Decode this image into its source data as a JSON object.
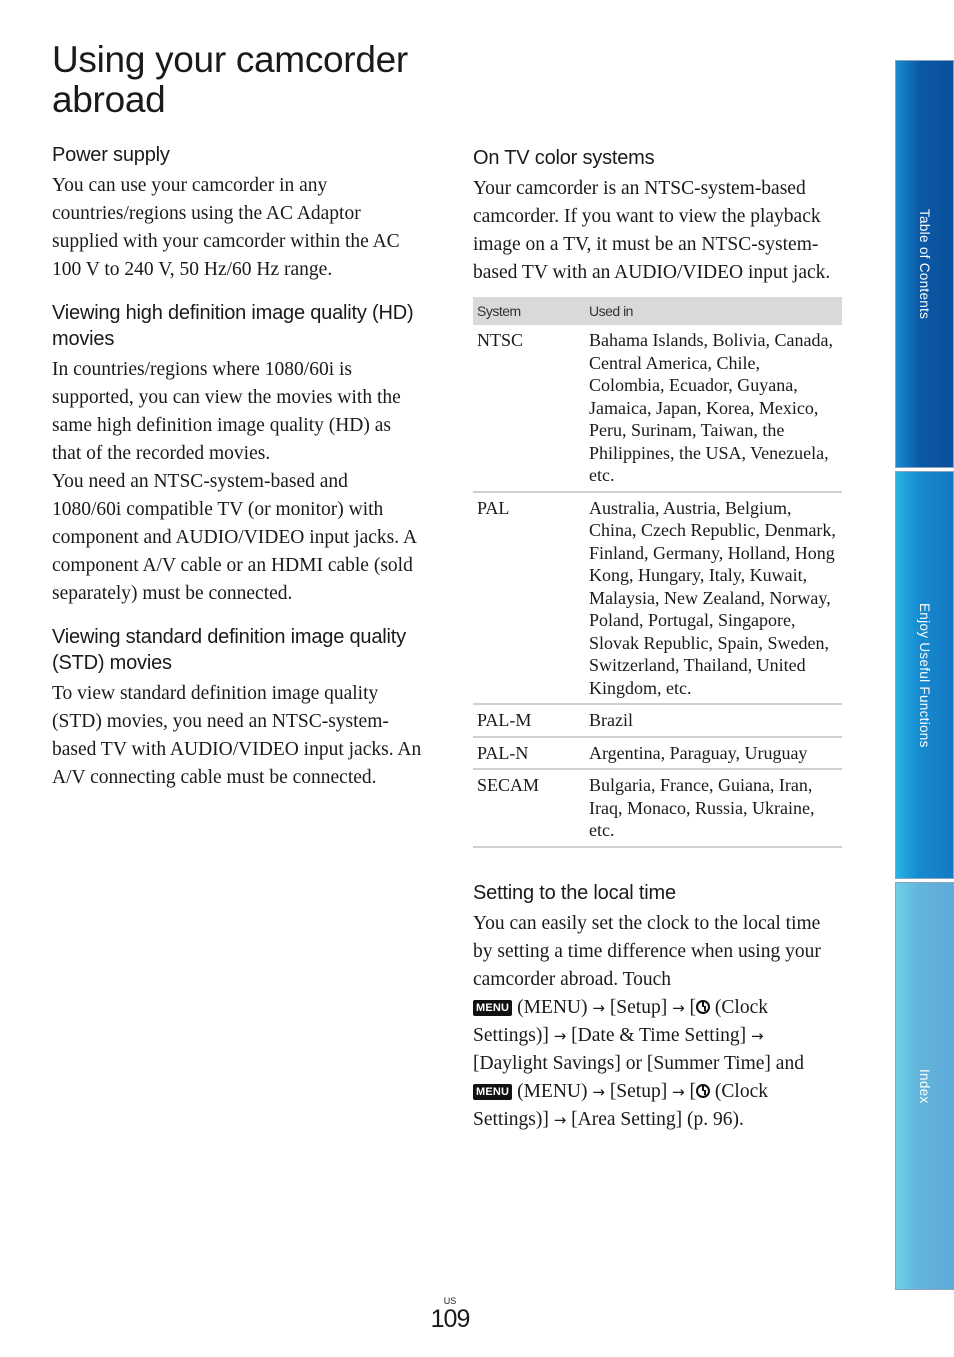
{
  "page_title": "Using your camcorder abroad",
  "left_column": {
    "sections": [
      {
        "heading": "Power supply",
        "paragraphs": [
          "You can use your camcorder in any countries/regions using the AC Adaptor supplied with your camcorder within the AC 100 V to 240 V, 50 Hz/60 Hz range."
        ]
      },
      {
        "heading": "Viewing high definition image quality (HD) movies",
        "paragraphs": [
          "In countries/regions where 1080/60i is supported, you can view the movies with the same high definition image quality (HD) as that of the recorded movies.",
          "You need an NTSC-system-based and 1080/60i compatible TV (or monitor) with component and AUDIO/VIDEO input jacks. A component A/V cable or an HDMI cable (sold separately) must be connected."
        ]
      },
      {
        "heading": "Viewing standard definition image quality (STD) movies",
        "paragraphs": [
          "To view standard definition image quality (STD) movies, you need an NTSC-system-based TV with AUDIO/VIDEO input jacks. An A/V connecting cable must be connected."
        ]
      }
    ]
  },
  "right_column": {
    "tv_section": {
      "heading": "On TV color systems",
      "paragraph": "Your camcorder is an NTSC-system-based camcorder. If you want to view the playback image on a TV, it must be an NTSC-system-based TV with an AUDIO/VIDEO input jack."
    },
    "table": {
      "headers": [
        "System",
        "Used in"
      ],
      "rows": [
        {
          "system": "NTSC",
          "used_in": "Bahama Islands, Bolivia, Canada, Central America, Chile, Colombia, Ecuador, Guyana, Jamaica, Japan, Korea, Mexico, Peru, Surinam, Taiwan, the Philippines, the USA, Venezuela, etc."
        },
        {
          "system": "PAL",
          "used_in": "Australia, Austria, Belgium, China, Czech Republic, Denmark, Finland, Germany, Holland, Hong Kong, Hungary, Italy, Kuwait, Malaysia, New Zealand, Norway, Poland, Portugal, Singapore, Slovak Republic, Spain, Sweden, Switzerland, Thailand, United Kingdom, etc."
        },
        {
          "system": "PAL-M",
          "used_in": "Brazil"
        },
        {
          "system": "PAL-N",
          "used_in": "Argentina, Paraguay, Uruguay"
        },
        {
          "system": "SECAM",
          "used_in": "Bulgaria, France, Guiana, Iran, Iraq, Monaco, Russia, Ukraine, etc."
        }
      ]
    },
    "local_time_section": {
      "heading": "Setting to the local time",
      "intro": "You can easily set the clock to the local time by setting a time difference when using your camcorder abroad. Touch",
      "menu_icon_label": "MENU",
      "menu_text": "(MENU)",
      "arrow": "→",
      "setup": "[Setup]",
      "clock_open": "[",
      "clock_text": "(Clock Settings)]",
      "date_time": "[Date & Time Setting]",
      "daylight": "[Daylight Savings] or [Summer Time] and",
      "area": "[Area Setting] (p. 96)."
    }
  },
  "sidebar": {
    "tabs": [
      {
        "label": "Table of Contents",
        "icon": "none"
      },
      {
        "label": "Enjoy Useful Functions",
        "icon": "none"
      },
      {
        "label": "Index",
        "icon": "none"
      }
    ]
  },
  "footer": {
    "region": "US",
    "page_number": "109"
  }
}
